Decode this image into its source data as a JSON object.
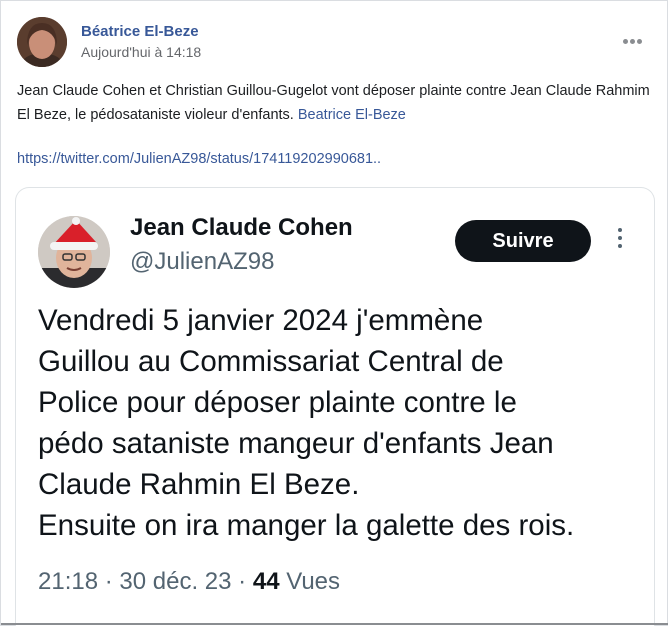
{
  "post": {
    "author": "Béatrice El-Beze",
    "timestamp": "Aujourd'hui à 14:18",
    "text_main": "Jean Claude Cohen et Christian Guillou-Gugelot vont déposer plainte contre Jean Claude Rahmim El Beze, le pédosataniste violeur d'enfants.",
    "text_mention": "Beatrice El-Beze",
    "link": "https://twitter.com/JulienAZ98/status/174119202990681..",
    "menu_icon": "more-horizontal-icon"
  },
  "tweet": {
    "name": "Jean Claude Cohen",
    "handle": "@JulienAZ98",
    "follow_label": "Suivre",
    "body_lines": [
      "Vendredi 5 janvier 2024 j'emmène",
      "Guillou au Commissariat Central de",
      "Police pour déposer plainte contre le",
      "pédo sataniste mangeur d'enfants Jean",
      "Claude Rahmin El Beze.",
      "Ensuite on ira manger la galette des rois."
    ],
    "time": "21:18",
    "date": "30 déc. 23",
    "views_count": "44",
    "views_label": "Vues",
    "separator": "·"
  },
  "colors": {
    "link": "#385898",
    "follow_button": "#0f1419",
    "muted": "#536471"
  }
}
